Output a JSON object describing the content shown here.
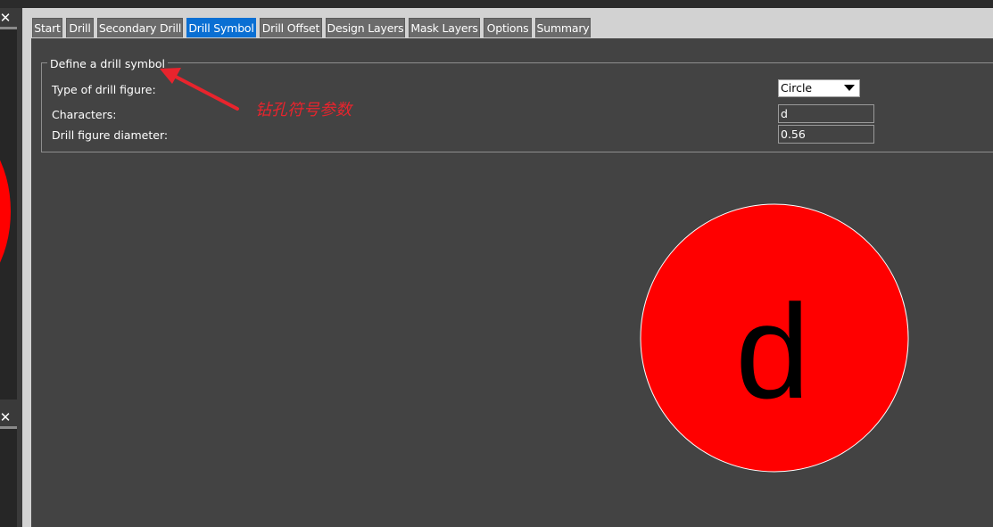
{
  "tabs": [
    {
      "label": "Start",
      "active": false
    },
    {
      "label": "Drill",
      "active": false
    },
    {
      "label": "Secondary Drill",
      "active": false
    },
    {
      "label": "Drill Symbol",
      "active": true
    },
    {
      "label": "Drill Offset",
      "active": false
    },
    {
      "label": "Design Layers",
      "active": false
    },
    {
      "label": "Mask Layers",
      "active": false
    },
    {
      "label": "Options",
      "active": false
    },
    {
      "label": "Summary",
      "active": false
    }
  ],
  "group": {
    "title": "Define a drill symbol",
    "fields": {
      "figure_type": {
        "label": "Type of drill figure:",
        "value": "Circle"
      },
      "characters": {
        "label": "Characters:",
        "value": "d"
      },
      "diameter": {
        "label": "Drill figure diameter:",
        "value": "0.56"
      }
    }
  },
  "annotation": {
    "text": "钻孔符号参数",
    "color": "#e8242d"
  },
  "preview": {
    "shape": "circle",
    "fill": "#ff0000",
    "character": "d"
  },
  "left_panel": {
    "close_glyph": "✕"
  }
}
